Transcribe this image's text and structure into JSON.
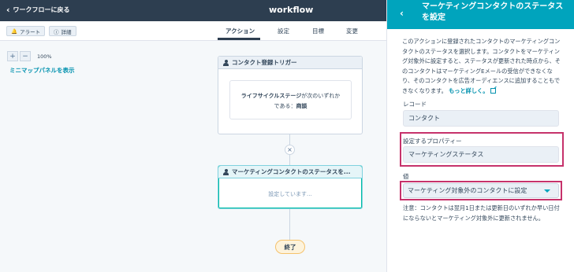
{
  "topbar": {
    "back_label": "ワークフローに戻る",
    "workflow_title": "workflow"
  },
  "subbar": {
    "alert_label": "アラート",
    "details_label": "詳細",
    "tabs": [
      {
        "label": "アクション",
        "active": true
      },
      {
        "label": "設定",
        "active": false
      },
      {
        "label": "目標",
        "active": false
      },
      {
        "label": "変更",
        "active": false
      }
    ]
  },
  "canvas": {
    "zoom_in": "+",
    "zoom_out": "−",
    "zoom_level": "100%",
    "minimap_link": "ミニマップパネルを表示",
    "trigger": {
      "title": "コンタクト登録トリガー",
      "condition_prop": "ライフサイクルステージ",
      "condition_suffix": "が次のいずれか",
      "condition_line2_prefix": "である：",
      "condition_value": "商談"
    },
    "remove_icon": "×",
    "action": {
      "title": "マーケティングコンタクトのステータスを...",
      "body": "設定しています..."
    },
    "end_label": "終了"
  },
  "panel": {
    "title": "マーケティングコンタクトのステータスを設定",
    "description": "このアクションに登録されたコンタクトのマーケティングコンタクトのステータスを選択します。コンタクトをマーケティング対象外に設定すると、ステータスが更新された時点から、そのコンタクトはマーケティングEメールの受信ができなくなり、そのコンタクトを広告オーディエンスに追加することもできなくなります。",
    "more_link": "もっと詳しく。",
    "record_label": "レコード",
    "record_value": "コンタクト",
    "property_label": "設定するプロパティー",
    "property_value": "マーケティングステータス",
    "value_label": "値",
    "value_selected": "マーケティング対象外のコンタクトに設定",
    "note": "注意：コンタクトは翌月1日または更新日のいずれか早い日付にならないとマーケティング対象外に更新されません。"
  },
  "colors": {
    "topbar": "#2d3e50",
    "panel_header": "#00a4bd",
    "highlight": "#c6326b",
    "link": "#0091ae"
  }
}
